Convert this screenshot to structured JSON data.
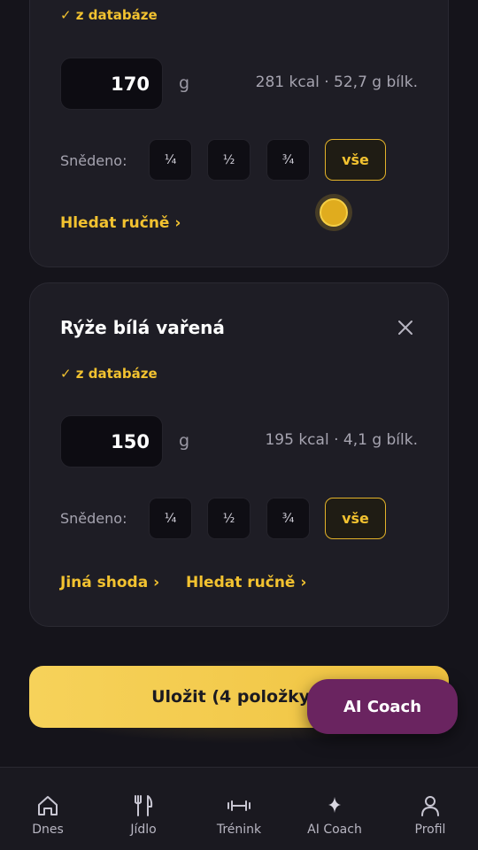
{
  "top_card": {
    "source": "✓ z databáze",
    "quantity": "170",
    "unit": "g",
    "macro": "281 kcal · 52,7 g bílk.",
    "eaten_label": "Snědeno:",
    "portions": [
      "¼",
      "½",
      "¾",
      "vše"
    ],
    "search_link": "Hledat ručně ›"
  },
  "rice_card": {
    "title": "Rýže bílá vařená",
    "source": "✓ z databáze",
    "quantity": "150",
    "unit": "g",
    "macro": "195 kcal · 4,1 g bílk.",
    "eaten_label": "Snědeno:",
    "portions": [
      "¼",
      "½",
      "¾",
      "vše"
    ],
    "other_match_link": "Jiná shoda ›",
    "search_link": "Hledat ručně ›"
  },
  "save_button": "Uložit (4 položky)",
  "ai_coach_button": "AI Coach",
  "nav": [
    {
      "label": "Dnes",
      "icon": "home-icon"
    },
    {
      "label": "Jídlo",
      "icon": "fork-knife-icon"
    },
    {
      "label": "Trénink",
      "icon": "dumbbell-icon"
    },
    {
      "label": "AI Coach",
      "icon": "sparkle-icon"
    },
    {
      "label": "Profil",
      "icon": "person-icon"
    }
  ],
  "colors": {
    "accent": "#f2c230",
    "background": "#15141b",
    "card": "#1e1d25",
    "coach": "#6a2460"
  }
}
